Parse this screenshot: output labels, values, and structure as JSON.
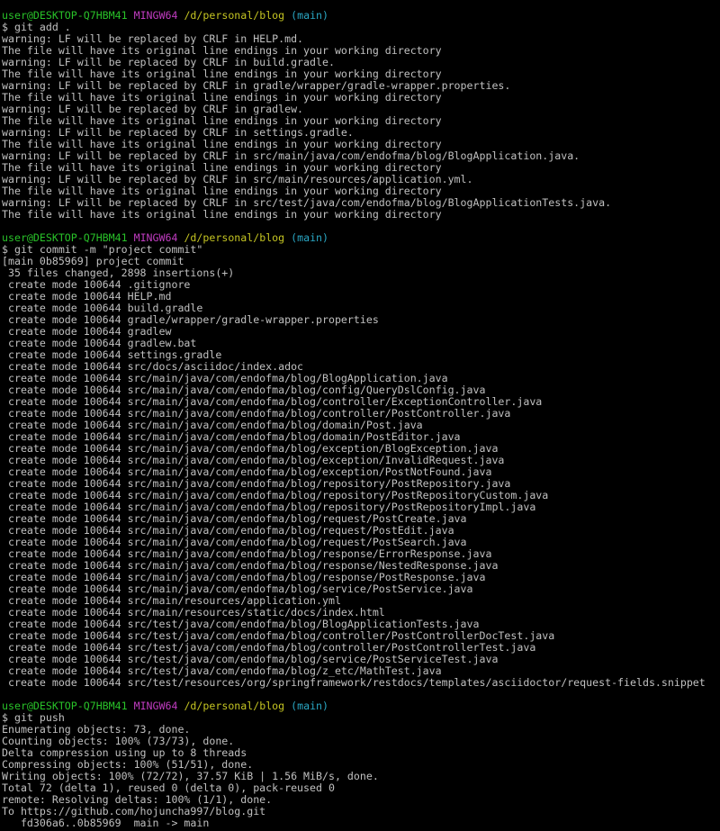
{
  "prompt": {
    "user_host": "user@DESKTOP-Q7HBM41",
    "system": "MINGW64",
    "path": "/d/personal/blog",
    "branch": "(main)"
  },
  "lines": [
    {
      "type": "prompt"
    },
    {
      "type": "text",
      "text": "$ git add ."
    },
    {
      "type": "text",
      "text": "warning: LF will be replaced by CRLF in HELP.md."
    },
    {
      "type": "text",
      "text": "The file will have its original line endings in your working directory"
    },
    {
      "type": "text",
      "text": "warning: LF will be replaced by CRLF in build.gradle."
    },
    {
      "type": "text",
      "text": "The file will have its original line endings in your working directory"
    },
    {
      "type": "text",
      "text": "warning: LF will be replaced by CRLF in gradle/wrapper/gradle-wrapper.properties."
    },
    {
      "type": "text",
      "text": "The file will have its original line endings in your working directory"
    },
    {
      "type": "text",
      "text": "warning: LF will be replaced by CRLF in gradlew."
    },
    {
      "type": "text",
      "text": "The file will have its original line endings in your working directory"
    },
    {
      "type": "text",
      "text": "warning: LF will be replaced by CRLF in settings.gradle."
    },
    {
      "type": "text",
      "text": "The file will have its original line endings in your working directory"
    },
    {
      "type": "text",
      "text": "warning: LF will be replaced by CRLF in src/main/java/com/endofma/blog/BlogApplication.java."
    },
    {
      "type": "text",
      "text": "The file will have its original line endings in your working directory"
    },
    {
      "type": "text",
      "text": "warning: LF will be replaced by CRLF in src/main/resources/application.yml."
    },
    {
      "type": "text",
      "text": "The file will have its original line endings in your working directory"
    },
    {
      "type": "text",
      "text": "warning: LF will be replaced by CRLF in src/test/java/com/endofma/blog/BlogApplicationTests.java."
    },
    {
      "type": "text",
      "text": "The file will have its original line endings in your working directory"
    },
    {
      "type": "blank"
    },
    {
      "type": "prompt"
    },
    {
      "type": "text",
      "text": "$ git commit -m \"project commit\""
    },
    {
      "type": "text",
      "text": "[main 0b85969] project commit"
    },
    {
      "type": "text",
      "text": " 35 files changed, 2898 insertions(+)"
    },
    {
      "type": "text",
      "text": " create mode 100644 .gitignore"
    },
    {
      "type": "text",
      "text": " create mode 100644 HELP.md"
    },
    {
      "type": "text",
      "text": " create mode 100644 build.gradle"
    },
    {
      "type": "text",
      "text": " create mode 100644 gradle/wrapper/gradle-wrapper.properties"
    },
    {
      "type": "text",
      "text": " create mode 100644 gradlew"
    },
    {
      "type": "text",
      "text": " create mode 100644 gradlew.bat"
    },
    {
      "type": "text",
      "text": " create mode 100644 settings.gradle"
    },
    {
      "type": "text",
      "text": " create mode 100644 src/docs/asciidoc/index.adoc"
    },
    {
      "type": "text",
      "text": " create mode 100644 src/main/java/com/endofma/blog/BlogApplication.java"
    },
    {
      "type": "text",
      "text": " create mode 100644 src/main/java/com/endofma/blog/config/QueryDslConfig.java"
    },
    {
      "type": "text",
      "text": " create mode 100644 src/main/java/com/endofma/blog/controller/ExceptionController.java"
    },
    {
      "type": "text",
      "text": " create mode 100644 src/main/java/com/endofma/blog/controller/PostController.java"
    },
    {
      "type": "text",
      "text": " create mode 100644 src/main/java/com/endofma/blog/domain/Post.java"
    },
    {
      "type": "text",
      "text": " create mode 100644 src/main/java/com/endofma/blog/domain/PostEditor.java"
    },
    {
      "type": "text",
      "text": " create mode 100644 src/main/java/com/endofma/blog/exception/BlogException.java"
    },
    {
      "type": "text",
      "text": " create mode 100644 src/main/java/com/endofma/blog/exception/InvalidRequest.java"
    },
    {
      "type": "text",
      "text": " create mode 100644 src/main/java/com/endofma/blog/exception/PostNotFound.java"
    },
    {
      "type": "text",
      "text": " create mode 100644 src/main/java/com/endofma/blog/repository/PostRepository.java"
    },
    {
      "type": "text",
      "text": " create mode 100644 src/main/java/com/endofma/blog/repository/PostRepositoryCustom.java"
    },
    {
      "type": "text",
      "text": " create mode 100644 src/main/java/com/endofma/blog/repository/PostRepositoryImpl.java"
    },
    {
      "type": "text",
      "text": " create mode 100644 src/main/java/com/endofma/blog/request/PostCreate.java"
    },
    {
      "type": "text",
      "text": " create mode 100644 src/main/java/com/endofma/blog/request/PostEdit.java"
    },
    {
      "type": "text",
      "text": " create mode 100644 src/main/java/com/endofma/blog/request/PostSearch.java"
    },
    {
      "type": "text",
      "text": " create mode 100644 src/main/java/com/endofma/blog/response/ErrorResponse.java"
    },
    {
      "type": "text",
      "text": " create mode 100644 src/main/java/com/endofma/blog/response/NestedResponse.java"
    },
    {
      "type": "text",
      "text": " create mode 100644 src/main/java/com/endofma/blog/response/PostResponse.java"
    },
    {
      "type": "text",
      "text": " create mode 100644 src/main/java/com/endofma/blog/service/PostService.java"
    },
    {
      "type": "text",
      "text": " create mode 100644 src/main/resources/application.yml"
    },
    {
      "type": "text",
      "text": " create mode 100644 src/main/resources/static/docs/index.html"
    },
    {
      "type": "text",
      "text": " create mode 100644 src/test/java/com/endofma/blog/BlogApplicationTests.java"
    },
    {
      "type": "text",
      "text": " create mode 100644 src/test/java/com/endofma/blog/controller/PostControllerDocTest.java"
    },
    {
      "type": "text",
      "text": " create mode 100644 src/test/java/com/endofma/blog/controller/PostControllerTest.java"
    },
    {
      "type": "text",
      "text": " create mode 100644 src/test/java/com/endofma/blog/service/PostServiceTest.java"
    },
    {
      "type": "text",
      "text": " create mode 100644 src/test/java/com/endofma/blog/z_etc/MathTest.java"
    },
    {
      "type": "text",
      "text": " create mode 100644 src/test/resources/org/springframework/restdocs/templates/asciidoctor/request-fields.snippet"
    },
    {
      "type": "blank"
    },
    {
      "type": "prompt"
    },
    {
      "type": "text",
      "text": "$ git push"
    },
    {
      "type": "text",
      "text": "Enumerating objects: 73, done."
    },
    {
      "type": "text",
      "text": "Counting objects: 100% (73/73), done."
    },
    {
      "type": "text",
      "text": "Delta compression using up to 8 threads"
    },
    {
      "type": "text",
      "text": "Compressing objects: 100% (51/51), done."
    },
    {
      "type": "text",
      "text": "Writing objects: 100% (72/72), 37.57 KiB | 1.56 MiB/s, done."
    },
    {
      "type": "text",
      "text": "Total 72 (delta 1), reused 0 (delta 0), pack-reused 0"
    },
    {
      "type": "text",
      "text": "remote: Resolving deltas: 100% (1/1), done."
    },
    {
      "type": "text",
      "text": "To https://github.com/hojuncha997/blog.git"
    },
    {
      "type": "text",
      "text": "   fd306a6..0b85969  main -> main"
    }
  ],
  "colors": {
    "background": "#000000",
    "text": "#c0c0c0",
    "user_host": "#29c229",
    "system": "#c03cc0",
    "path": "#c4c422",
    "branch": "#2aa7c4"
  }
}
